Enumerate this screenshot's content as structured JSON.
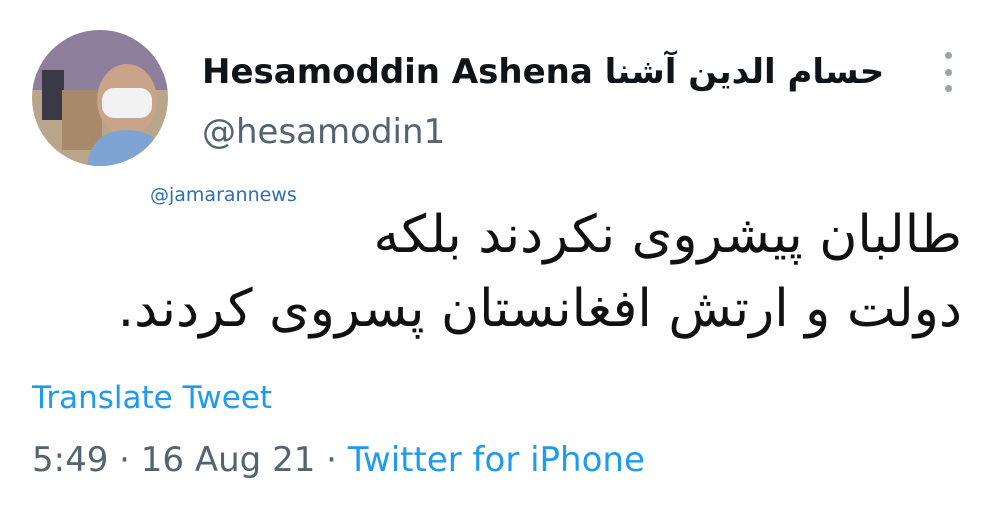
{
  "author": {
    "display_name": "Hesamoddin Ashena حسام الدین آشنا",
    "handle": "@hesamodin1"
  },
  "watermark": "@jamarannews",
  "tweet": {
    "lines": [
      "طالبان پیشروی نکردند بلکه",
      "دولت و ارتش افغانستان پسروی کردند."
    ]
  },
  "actions": {
    "translate_label": "Translate Tweet"
  },
  "meta": {
    "time": "5:49",
    "separator": "·",
    "date": "16 Aug 21",
    "source": "Twitter for iPhone"
  },
  "icons": {
    "more": "more-vertical-icon"
  },
  "colors": {
    "link": "#1d9bf0",
    "muted": "#536471",
    "watermark": "#2d6fb3"
  }
}
